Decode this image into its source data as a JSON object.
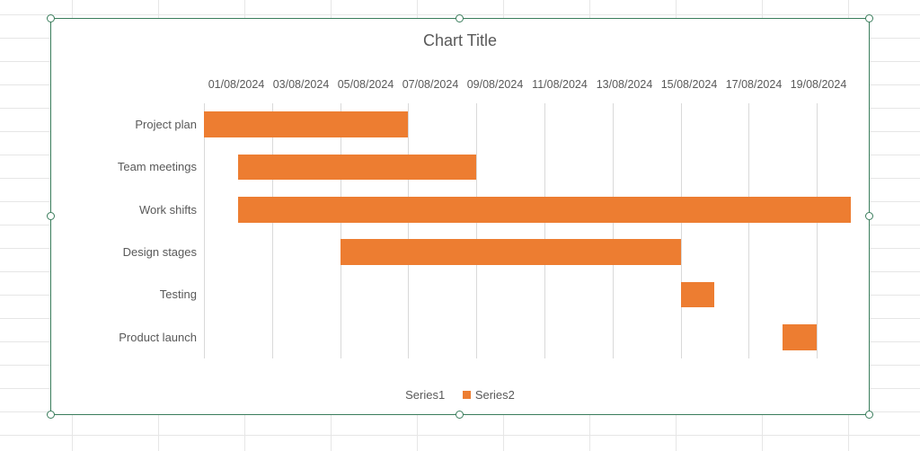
{
  "chart_data": {
    "type": "bar",
    "orientation": "horizontal",
    "title": "Chart Title",
    "x_axis": {
      "type": "date",
      "format": "dd/mm/yyyy",
      "position": "top",
      "ticks": [
        "01/08/2024",
        "03/08/2024",
        "05/08/2024",
        "07/08/2024",
        "09/08/2024",
        "11/08/2024",
        "13/08/2024",
        "15/08/2024",
        "17/08/2024",
        "19/08/2024"
      ],
      "min": "01/08/2024",
      "max": "20/08/2024"
    },
    "categories": [
      "Project plan",
      "Team meetings",
      "Work shifts",
      "Design stages",
      "Testing",
      "Product launch"
    ],
    "series": [
      {
        "name": "Series1",
        "role": "offset_days_from_start",
        "color": null,
        "values": [
          0,
          1,
          1,
          4,
          14,
          17
        ]
      },
      {
        "name": "Series2",
        "role": "duration_days",
        "color": "#ed7d31",
        "values": [
          6,
          7,
          18,
          10,
          1,
          1
        ]
      }
    ],
    "legend": {
      "position": "bottom",
      "items": [
        "Series1",
        "Series2"
      ]
    },
    "grid": {
      "vertical": true,
      "horizontal": false
    },
    "notes": "Stacked horizontal bar acting as a Gantt chart; Series1 (invisible) is the start-date offset, Series2 (orange) is the task duration."
  },
  "colors": {
    "bar": "#ed7d31",
    "frame_border": "#3a7d5c",
    "text": "#595959",
    "grid": "#d9d9d9"
  }
}
